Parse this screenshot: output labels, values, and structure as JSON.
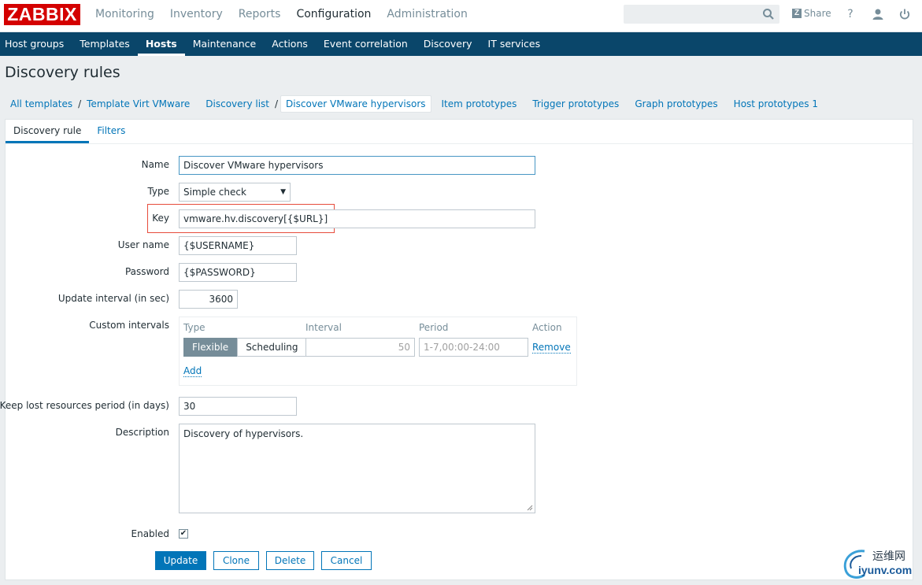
{
  "brand": {
    "logo_text": "ZABBIX",
    "color": "#d40000"
  },
  "top_menu": [
    {
      "label": "Monitoring",
      "active": false
    },
    {
      "label": "Inventory",
      "active": false
    },
    {
      "label": "Reports",
      "active": false
    },
    {
      "label": "Configuration",
      "active": true
    },
    {
      "label": "Administration",
      "active": false
    }
  ],
  "header": {
    "search_value": "",
    "share_label": "Share",
    "share_badge": "Z",
    "help_icon": "question-icon",
    "profile_icon": "user-icon",
    "logout_icon": "power-icon"
  },
  "sub_menu": [
    {
      "label": "Host groups"
    },
    {
      "label": "Templates"
    },
    {
      "label": "Hosts",
      "active": true
    },
    {
      "label": "Maintenance"
    },
    {
      "label": "Actions"
    },
    {
      "label": "Event correlation"
    },
    {
      "label": "Discovery"
    },
    {
      "label": "IT services"
    }
  ],
  "page_title": "Discovery rules",
  "breadcrumbs": {
    "all_templates": "All templates",
    "sep": "/",
    "template": "Template Virt VMware",
    "discovery_list": "Discovery list",
    "current": "Discover VMware hypervisors",
    "item_prototypes": "Item prototypes",
    "trigger_prototypes": "Trigger prototypes",
    "graph_prototypes": "Graph prototypes",
    "host_prototypes": "Host prototypes 1"
  },
  "tabs": {
    "discovery_rule": "Discovery rule",
    "filters": "Filters"
  },
  "form": {
    "name_label": "Name",
    "name_value": "Discover VMware hypervisors",
    "type_label": "Type",
    "type_value": "Simple check",
    "key_label": "Key",
    "key_value": "vmware.hv.discovery[{$URL}]",
    "username_label": "User name",
    "username_value": "{$USERNAME}",
    "password_label": "Password",
    "password_value": "{$PASSWORD}",
    "interval_label": "Update interval (in sec)",
    "interval_value": "3600",
    "custom_intervals_label": "Custom intervals",
    "custom_intervals": {
      "col_type": "Type",
      "col_interval": "Interval",
      "col_period": "Period",
      "col_action": "Action",
      "flexible": "Flexible",
      "scheduling": "Scheduling",
      "interval_value": "50",
      "period_value": "1-7,00:00-24:00",
      "remove": "Remove",
      "add": "Add"
    },
    "keep_lost_label": "Keep lost resources period (in days)",
    "keep_lost_value": "30",
    "description_label": "Description",
    "description_value": "Discovery of hypervisors.",
    "enabled_label": "Enabled",
    "enabled_checked": true
  },
  "buttons": {
    "update": "Update",
    "clone": "Clone",
    "delete": "Delete",
    "cancel": "Cancel"
  },
  "watermark": {
    "cn": "运维网",
    "en": "iyunv.com"
  },
  "colors": {
    "accent": "#0275b8",
    "nav_bg": "#0a466a",
    "highlight": "#e74c3c"
  }
}
